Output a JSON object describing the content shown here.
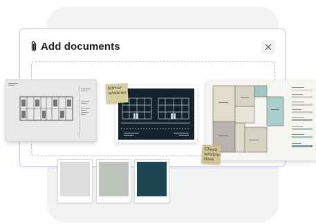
{
  "dialog": {
    "title": "Add documents",
    "close_label": "×"
  },
  "icons": {
    "attach": "paperclip-icon",
    "close": "close-icon"
  },
  "notes": {
    "window_note": "Mirror windows",
    "desk_note": "Check window sizes"
  },
  "swatches": [
    {
      "name": "light-grey",
      "color": "#dcdedb"
    },
    {
      "name": "sage-grey",
      "color": "#bdc2bd"
    },
    {
      "name": "deep-teal",
      "color": "#1f4553"
    }
  ],
  "colors": {
    "accent_border": "#c9d2e4",
    "background_panel": "#f3f3f4",
    "title_text": "#1d1d1f"
  }
}
